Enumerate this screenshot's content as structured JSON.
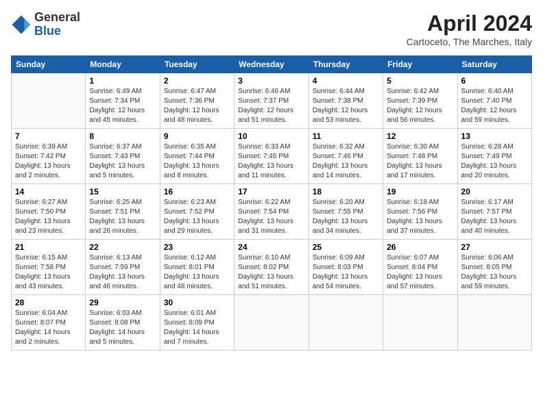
{
  "header": {
    "logo": {
      "general": "General",
      "blue": "Blue"
    },
    "title": "April 2024",
    "subtitle": "Cartoceto, The Marches, Italy"
  },
  "calendar": {
    "days_of_week": [
      "Sunday",
      "Monday",
      "Tuesday",
      "Wednesday",
      "Thursday",
      "Friday",
      "Saturday"
    ],
    "weeks": [
      [
        {
          "day": "",
          "info": ""
        },
        {
          "day": "1",
          "info": "Sunrise: 6:49 AM\nSunset: 7:34 PM\nDaylight: 12 hours\nand 45 minutes."
        },
        {
          "day": "2",
          "info": "Sunrise: 6:47 AM\nSunset: 7:36 PM\nDaylight: 12 hours\nand 48 minutes."
        },
        {
          "day": "3",
          "info": "Sunrise: 6:46 AM\nSunset: 7:37 PM\nDaylight: 12 hours\nand 51 minutes."
        },
        {
          "day": "4",
          "info": "Sunrise: 6:44 AM\nSunset: 7:38 PM\nDaylight: 12 hours\nand 53 minutes."
        },
        {
          "day": "5",
          "info": "Sunrise: 6:42 AM\nSunset: 7:39 PM\nDaylight: 12 hours\nand 56 minutes."
        },
        {
          "day": "6",
          "info": "Sunrise: 6:40 AM\nSunset: 7:40 PM\nDaylight: 12 hours\nand 59 minutes."
        }
      ],
      [
        {
          "day": "7",
          "info": "Sunrise: 6:39 AM\nSunset: 7:42 PM\nDaylight: 13 hours\nand 2 minutes."
        },
        {
          "day": "8",
          "info": "Sunrise: 6:37 AM\nSunset: 7:43 PM\nDaylight: 13 hours\nand 5 minutes."
        },
        {
          "day": "9",
          "info": "Sunrise: 6:35 AM\nSunset: 7:44 PM\nDaylight: 13 hours\nand 8 minutes."
        },
        {
          "day": "10",
          "info": "Sunrise: 6:33 AM\nSunset: 7:45 PM\nDaylight: 13 hours\nand 11 minutes."
        },
        {
          "day": "11",
          "info": "Sunrise: 6:32 AM\nSunset: 7:46 PM\nDaylight: 13 hours\nand 14 minutes."
        },
        {
          "day": "12",
          "info": "Sunrise: 6:30 AM\nSunset: 7:48 PM\nDaylight: 13 hours\nand 17 minutes."
        },
        {
          "day": "13",
          "info": "Sunrise: 6:28 AM\nSunset: 7:49 PM\nDaylight: 13 hours\nand 20 minutes."
        }
      ],
      [
        {
          "day": "14",
          "info": "Sunrise: 6:27 AM\nSunset: 7:50 PM\nDaylight: 13 hours\nand 23 minutes."
        },
        {
          "day": "15",
          "info": "Sunrise: 6:25 AM\nSunset: 7:51 PM\nDaylight: 13 hours\nand 26 minutes."
        },
        {
          "day": "16",
          "info": "Sunrise: 6:23 AM\nSunset: 7:52 PM\nDaylight: 13 hours\nand 29 minutes."
        },
        {
          "day": "17",
          "info": "Sunrise: 6:22 AM\nSunset: 7:54 PM\nDaylight: 13 hours\nand 31 minutes."
        },
        {
          "day": "18",
          "info": "Sunrise: 6:20 AM\nSunset: 7:55 PM\nDaylight: 13 hours\nand 34 minutes."
        },
        {
          "day": "19",
          "info": "Sunrise: 6:18 AM\nSunset: 7:56 PM\nDaylight: 13 hours\nand 37 minutes."
        },
        {
          "day": "20",
          "info": "Sunrise: 6:17 AM\nSunset: 7:57 PM\nDaylight: 13 hours\nand 40 minutes."
        }
      ],
      [
        {
          "day": "21",
          "info": "Sunrise: 6:15 AM\nSunset: 7:58 PM\nDaylight: 13 hours\nand 43 minutes."
        },
        {
          "day": "22",
          "info": "Sunrise: 6:13 AM\nSunset: 7:59 PM\nDaylight: 13 hours\nand 46 minutes."
        },
        {
          "day": "23",
          "info": "Sunrise: 6:12 AM\nSunset: 8:01 PM\nDaylight: 13 hours\nand 48 minutes."
        },
        {
          "day": "24",
          "info": "Sunrise: 6:10 AM\nSunset: 8:02 PM\nDaylight: 13 hours\nand 51 minutes."
        },
        {
          "day": "25",
          "info": "Sunrise: 6:09 AM\nSunset: 8:03 PM\nDaylight: 13 hours\nand 54 minutes."
        },
        {
          "day": "26",
          "info": "Sunrise: 6:07 AM\nSunset: 8:04 PM\nDaylight: 13 hours\nand 57 minutes."
        },
        {
          "day": "27",
          "info": "Sunrise: 6:06 AM\nSunset: 8:05 PM\nDaylight: 13 hours\nand 59 minutes."
        }
      ],
      [
        {
          "day": "28",
          "info": "Sunrise: 6:04 AM\nSunset: 8:07 PM\nDaylight: 14 hours\nand 2 minutes."
        },
        {
          "day": "29",
          "info": "Sunrise: 6:03 AM\nSunset: 8:08 PM\nDaylight: 14 hours\nand 5 minutes."
        },
        {
          "day": "30",
          "info": "Sunrise: 6:01 AM\nSunset: 8:09 PM\nDaylight: 14 hours\nand 7 minutes."
        },
        {
          "day": "",
          "info": ""
        },
        {
          "day": "",
          "info": ""
        },
        {
          "day": "",
          "info": ""
        },
        {
          "day": "",
          "info": ""
        }
      ]
    ]
  }
}
